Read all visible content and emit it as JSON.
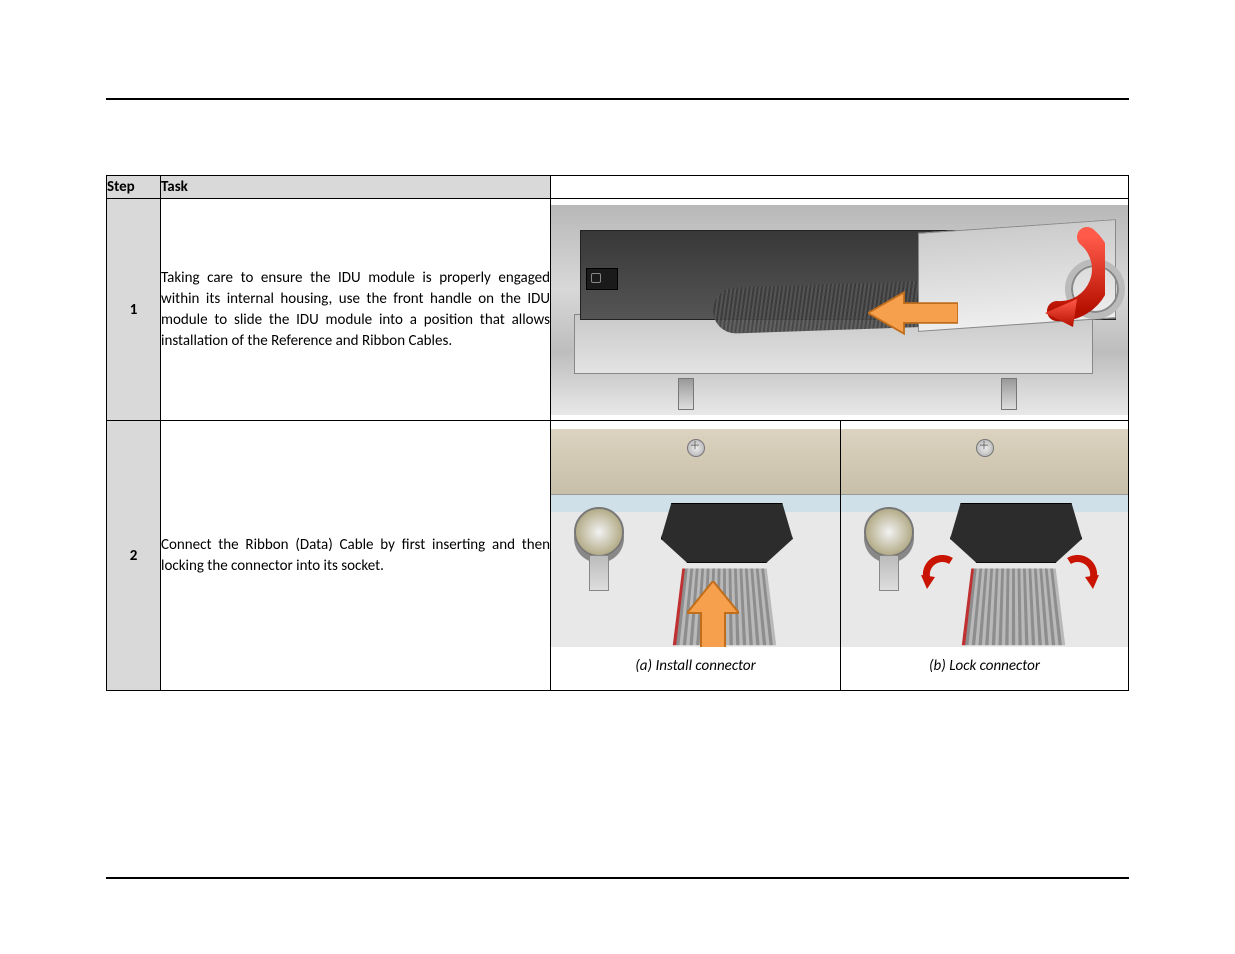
{
  "table": {
    "headers": {
      "step": "Step",
      "task": "Task"
    },
    "rows": [
      {
        "num": "1",
        "task": "Taking care to ensure the IDU module is properly engaged within its internal housing, use the front handle on the IDU module to slide the IDU module into a position that allows installation of the Reference and Ribbon Cables."
      },
      {
        "num": "2",
        "task": "Connect the Ribbon (Data) Cable by first inserting and  then locking the connector into its socket.",
        "caption_a": "(a)  Install connector",
        "caption_b": "(b)  Lock connector"
      }
    ]
  },
  "icons": {
    "orange_left_arrow": "orange-left-arrow",
    "red_curved_arrow": "red-curved-arrow",
    "orange_up_arrow": "orange-up-arrow",
    "red_lock_arrow": "red-lock-arrow"
  }
}
